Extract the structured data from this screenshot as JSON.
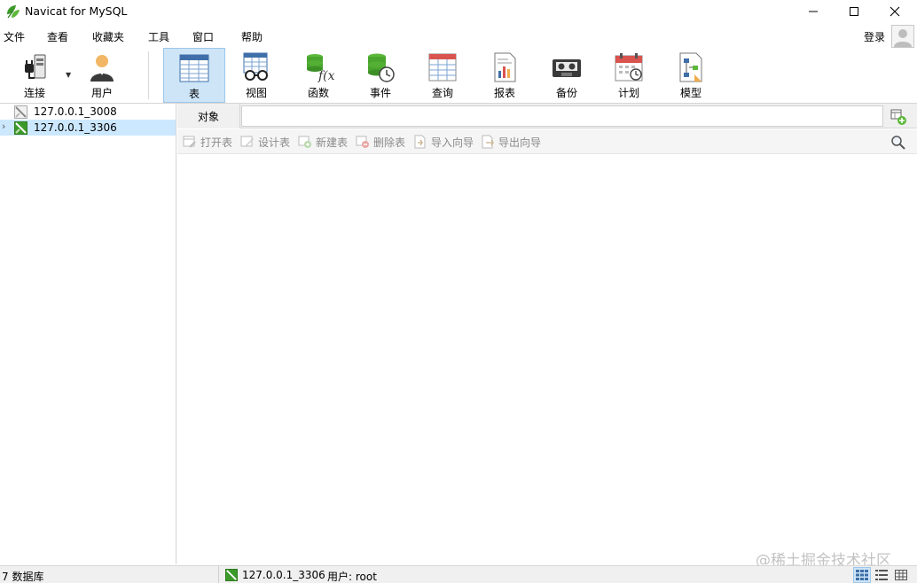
{
  "app": {
    "title": "Navicat for MySQL",
    "logo_icon": "navicat-leaf-icon",
    "accent_color": "#3c9a2a"
  },
  "window_controls": [
    "minimize-icon",
    "maximize-icon",
    "close-icon"
  ],
  "menu": {
    "items": [
      "文件",
      "查看",
      "收藏夹",
      "工具",
      "窗口",
      "帮助"
    ],
    "login_label": "登录"
  },
  "toolbar": {
    "items": [
      {
        "label": "连接",
        "icon": "plug-icon"
      },
      {
        "label": "用户",
        "icon": "user-icon"
      },
      {
        "label": "表",
        "icon": "table-icon",
        "active": true
      },
      {
        "label": "视图",
        "icon": "view-glasses-icon"
      },
      {
        "label": "函数",
        "icon": "function-icon"
      },
      {
        "label": "事件",
        "icon": "event-clock-icon"
      },
      {
        "label": "查询",
        "icon": "query-icon"
      },
      {
        "label": "报表",
        "icon": "report-icon"
      },
      {
        "label": "备份",
        "icon": "backup-tape-icon"
      },
      {
        "label": "计划",
        "icon": "calendar-schedule-icon"
      },
      {
        "label": "模型",
        "icon": "model-diagram-icon"
      }
    ]
  },
  "sidebar": {
    "connections": [
      {
        "label": "127.0.0.1_3008",
        "connected": false,
        "selected": false
      },
      {
        "label": "127.0.0.1_3306",
        "connected": true,
        "selected": true
      }
    ]
  },
  "object_panel": {
    "tab_label": "对象",
    "search_value": "",
    "actions": [
      {
        "label": "打开表",
        "icon": "open-table-icon"
      },
      {
        "label": "设计表",
        "icon": "design-table-icon"
      },
      {
        "label": "新建表",
        "icon": "new-table-icon"
      },
      {
        "label": "删除表",
        "icon": "delete-table-icon"
      },
      {
        "label": "导入向导",
        "icon": "import-wizard-icon"
      },
      {
        "label": "导出向导",
        "icon": "export-wizard-icon"
      }
    ]
  },
  "status": {
    "db_count": "7 数据库",
    "connection": "127.0.0.1_3306",
    "user": "用户: root"
  },
  "watermark": "@稀土掘金技术社区"
}
